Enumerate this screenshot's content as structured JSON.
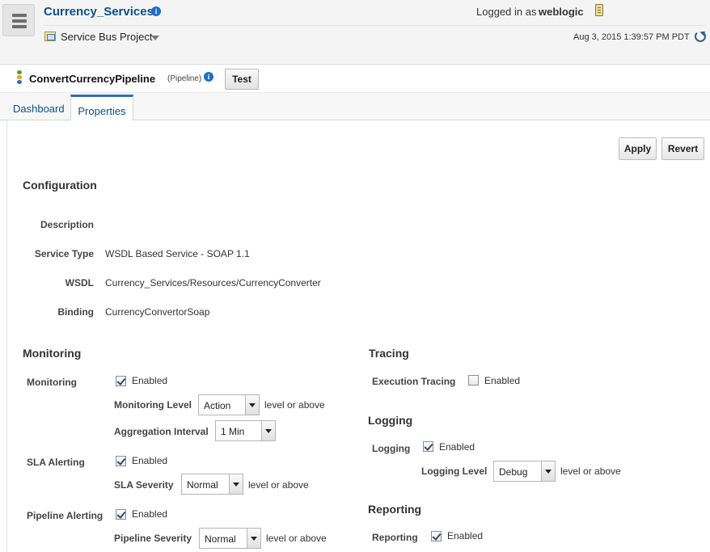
{
  "header": {
    "app_title": "Currency_Services",
    "logged_in_label": "Logged in as",
    "user": "weblogic",
    "project": "Service Bus Project",
    "timestamp": "Aug 3, 2015 1:39:57 PM PDT",
    "info_glyph": "i"
  },
  "pipeline": {
    "name": "ConvertCurrencyPipeline",
    "type": "(Pipeline)",
    "test_label": "Test"
  },
  "tabs": [
    {
      "label": "Dashboard",
      "active": false
    },
    {
      "label": "Properties",
      "active": true
    }
  ],
  "actions": {
    "apply": "Apply",
    "revert": "Revert"
  },
  "configuration": {
    "title": "Configuration",
    "description_label": "Description",
    "description": "",
    "service_type_label": "Service Type",
    "service_type": "WSDL Based Service - SOAP 1.1",
    "wsdl_label": "WSDL",
    "wsdl": "Currency_Services/Resources/CurrencyConverter",
    "binding_label": "Binding",
    "binding": "CurrencyConvertorSoap"
  },
  "monitoring": {
    "title": "Monitoring",
    "monitoring_label": "Monitoring",
    "enabled_label": "Enabled",
    "monitoring_enabled": true,
    "level_label": "Monitoring Level",
    "level": "Action",
    "level_suffix": "level or above",
    "aggregation_label": "Aggregation Interval",
    "aggregation": "1 Min",
    "sla_label": "SLA Alerting",
    "sla_enabled": true,
    "sla_severity_label": "SLA Severity",
    "sla_severity": "Normal",
    "pipeline_label": "Pipeline Alerting",
    "pipeline_enabled": true,
    "pipeline_severity_label": "Pipeline Severity",
    "pipeline_severity": "Normal"
  },
  "tracing": {
    "title": "Tracing",
    "execution_label": "Execution Tracing",
    "enabled_label": "Enabled",
    "enabled": false
  },
  "logging": {
    "title": "Logging",
    "logging_label": "Logging",
    "enabled_label": "Enabled",
    "enabled": true,
    "level_label": "Logging Level",
    "level": "Debug",
    "level_suffix": "level or above"
  },
  "reporting": {
    "title": "Reporting",
    "reporting_label": "Reporting",
    "enabled_label": "Enabled",
    "enabled": true
  },
  "colors": {
    "link_blue": "#0b4f8c",
    "tab_accent": "#2e6db6",
    "info_blue": "#1f6fc6"
  }
}
